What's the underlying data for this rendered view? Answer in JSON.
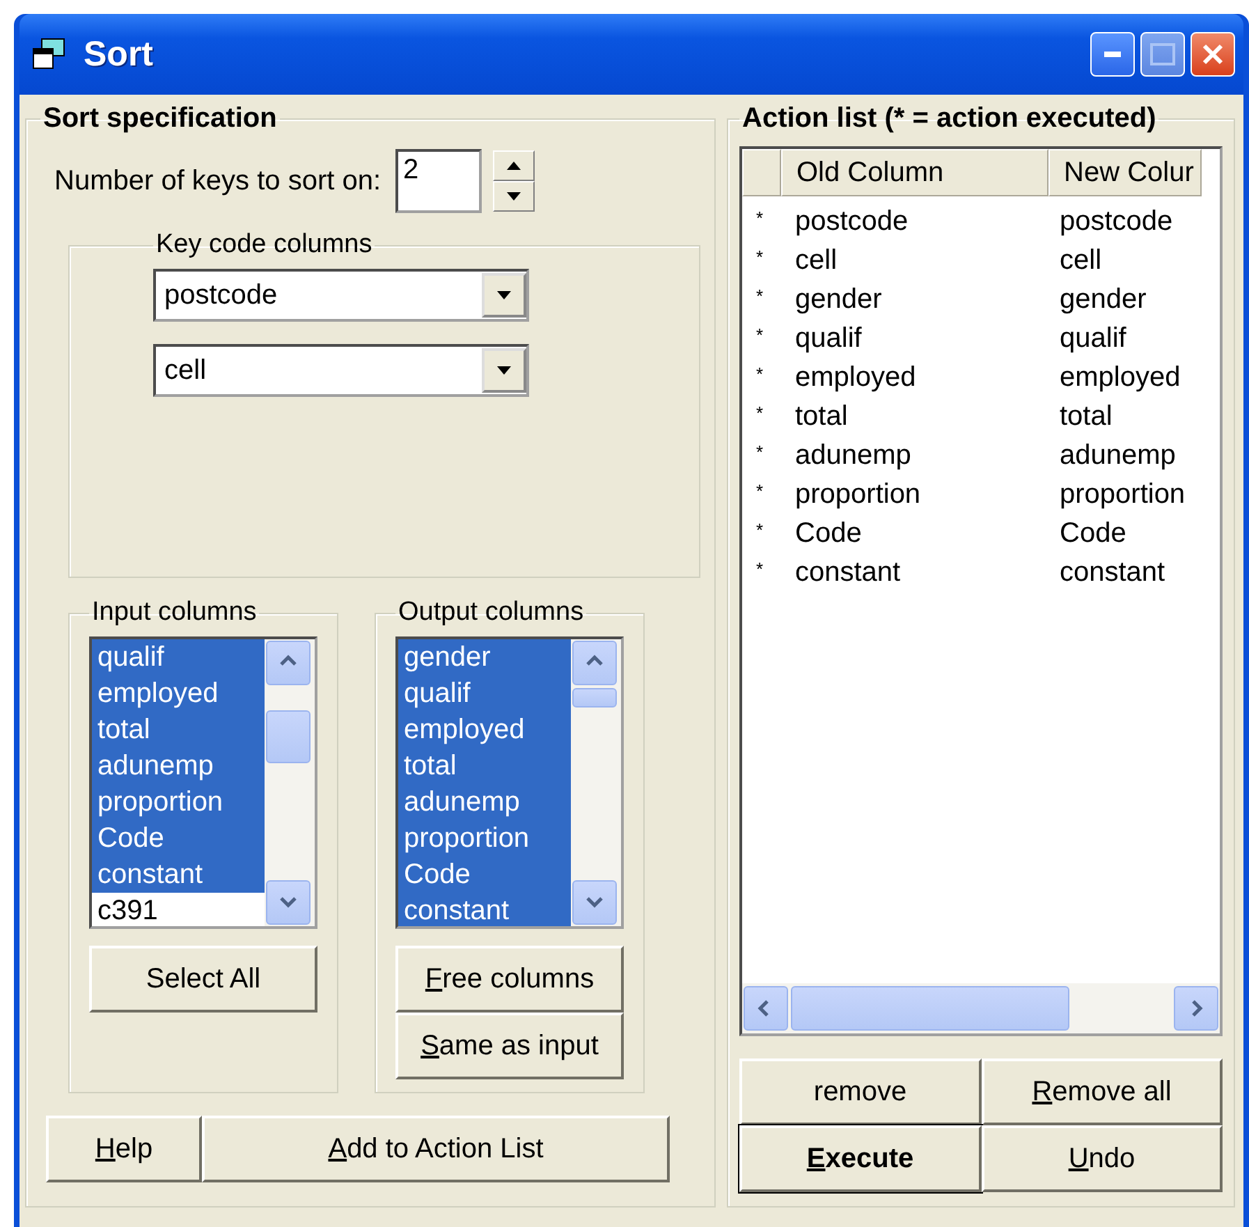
{
  "window": {
    "title": "Sort"
  },
  "sort_spec": {
    "title": "Sort  specification",
    "keys_label": "Number of keys to sort on:",
    "keys_value": "2",
    "key_columns": {
      "title": "Key code columns",
      "combos": [
        "postcode",
        "cell"
      ]
    },
    "input_columns": {
      "title": "Input columns",
      "items": [
        {
          "label": "qualif",
          "selected": true
        },
        {
          "label": "employed",
          "selected": true
        },
        {
          "label": "total",
          "selected": true
        },
        {
          "label": "adunemp",
          "selected": true
        },
        {
          "label": "proportion",
          "selected": true
        },
        {
          "label": "Code",
          "selected": true
        },
        {
          "label": "constant",
          "selected": true
        },
        {
          "label": "c391",
          "selected": false
        }
      ],
      "buttons": [
        {
          "label": "Select All",
          "underline_first": false
        }
      ]
    },
    "output_columns": {
      "title": "Output columns",
      "items": [
        {
          "label": "gender",
          "selected": true
        },
        {
          "label": "qualif",
          "selected": true
        },
        {
          "label": "employed",
          "selected": true
        },
        {
          "label": "total",
          "selected": true
        },
        {
          "label": "adunemp",
          "selected": true
        },
        {
          "label": "proportion",
          "selected": true
        },
        {
          "label": "Code",
          "selected": true
        },
        {
          "label": "constant",
          "selected": true
        }
      ],
      "buttons": [
        {
          "label": "Free columns",
          "underline_first": true
        },
        {
          "label": "Same as input",
          "underline_first": true
        }
      ]
    },
    "buttons": [
      {
        "label": "Help",
        "underline_first": true
      },
      {
        "label": "Add to Action List",
        "underline_first": true
      }
    ]
  },
  "action_list": {
    "title": "Action list (* = action executed)",
    "columns": [
      "Old Column",
      "New Colur"
    ],
    "rows": [
      {
        "mark": "*",
        "old": "postcode",
        "new": "postcode"
      },
      {
        "mark": "*",
        "old": "cell",
        "new": "cell"
      },
      {
        "mark": "*",
        "old": "gender",
        "new": "gender"
      },
      {
        "mark": "*",
        "old": "qualif",
        "new": "qualif"
      },
      {
        "mark": "*",
        "old": "employed",
        "new": "employed"
      },
      {
        "mark": "*",
        "old": "total",
        "new": "total"
      },
      {
        "mark": "*",
        "old": "adunemp",
        "new": "adunemp"
      },
      {
        "mark": "*",
        "old": "proportion",
        "new": "proportion"
      },
      {
        "mark": "*",
        "old": "Code",
        "new": "Code"
      },
      {
        "mark": "*",
        "old": "constant",
        "new": "constant"
      }
    ],
    "buttons": [
      {
        "label": "remove",
        "underline_first": false,
        "default": false
      },
      {
        "label": "Remove all",
        "underline_first": true,
        "default": false
      },
      {
        "label": "Execute",
        "underline_first": true,
        "default": true
      },
      {
        "label": "Undo",
        "underline_first": true,
        "default": false
      }
    ]
  }
}
